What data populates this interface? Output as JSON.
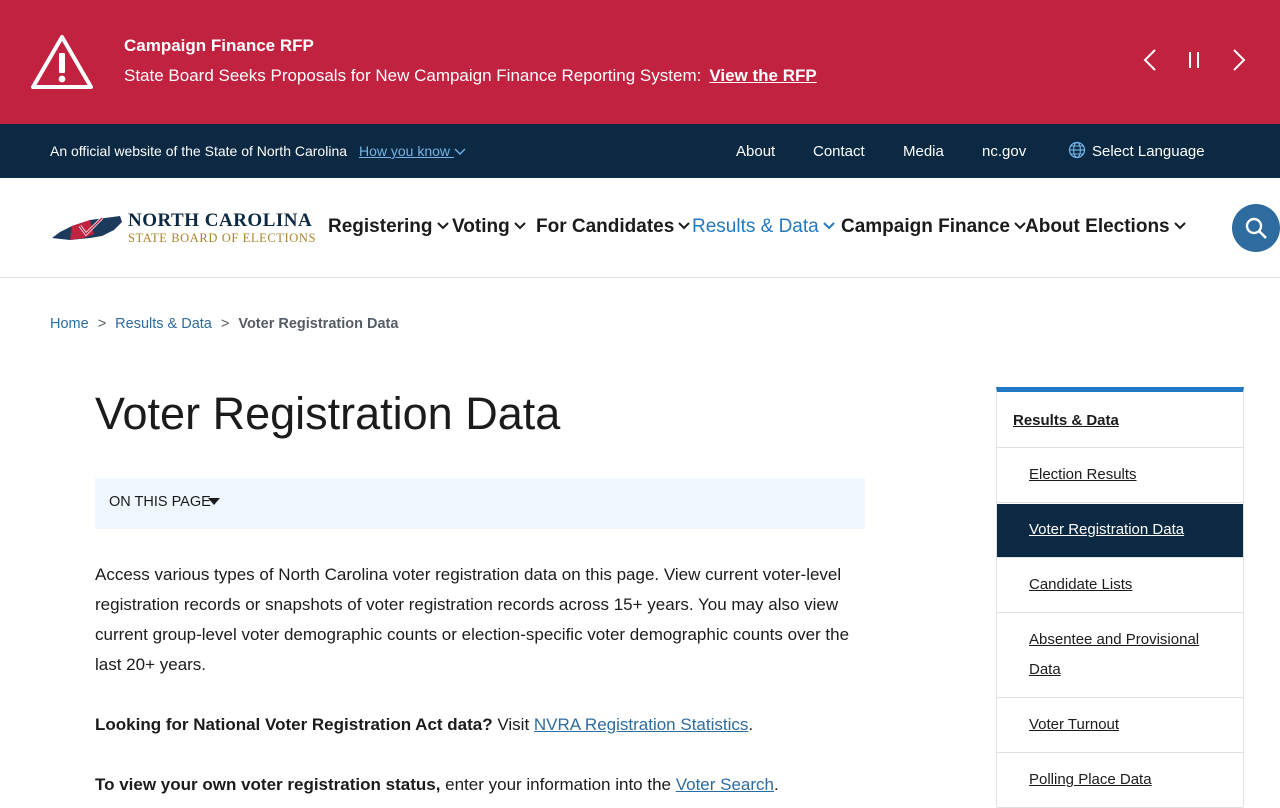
{
  "alert": {
    "title": "Campaign Finance RFP",
    "text": "State Board Seeks Proposals for New Campaign Finance Reporting System:",
    "link": "View the RFP"
  },
  "official": {
    "text": "An official website of the State of North Carolina",
    "how_know": "How you know",
    "links": [
      "About",
      "Contact",
      "Media",
      "nc.gov"
    ],
    "language": "Select Language"
  },
  "logo": {
    "line1": "NORTH CAROLINA",
    "line2": "STATE BOARD OF ELECTIONS"
  },
  "nav": [
    "Registering",
    "Voting",
    "For Candidates",
    "Results & Data",
    "Campaign Finance",
    "About Elections"
  ],
  "breadcrumb": {
    "home": "Home",
    "parent": "Results & Data",
    "current": "Voter Registration Data",
    "separator": ">"
  },
  "main": {
    "title": "Voter Registration Data",
    "on_this_page": "ON THIS PAGE",
    "intro": "Access various types of North Carolina voter registration data on this page. View current voter-level registration records or snapshots of voter registration records across 15+ years. You may also view current group-level voter demographic counts or election-specific voter demographic counts over the last 20+ years.",
    "nvra_bold": "Looking for National Voter Registration Act data?",
    "nvra_text": " Visit ",
    "nvra_link": "NVRA Registration Statistics",
    "nvra_end": ".",
    "status_bold": "To view your own voter registration status,",
    "status_text": " enter your information into the ",
    "status_link": "Voter Search",
    "status_end": "."
  },
  "sidebar": {
    "heading": "Results & Data",
    "items": [
      "Election Results",
      "Voter Registration Data",
      "Candidate Lists",
      "Absentee and Provisional Data",
      "Voter Turnout",
      "Polling Place Data"
    ]
  },
  "colors": {
    "alert_bg": "#c0223f",
    "official_bg": "#0b2942",
    "accent": "#2378c3",
    "link": "#2e6b9e"
  }
}
